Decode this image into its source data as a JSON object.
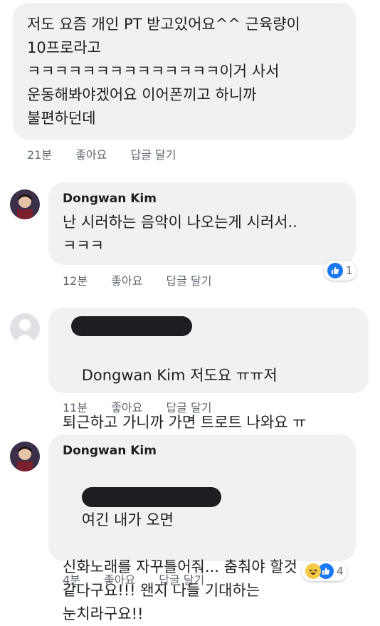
{
  "comment1": {
    "text": "저도 요즘 개인 PT 받고있어요^^ 근육량이\n10프로라고\nㅋㅋㅋㅋㅋㅋㅋㅋㅋㅋㅋㅋㅋㅋ이거 사서\n운동해봐야겠어요 이어폰끼고 하니까\n불편하던데",
    "time": "21분",
    "like": "좋아요",
    "reply": "답글 달기"
  },
  "comment2": {
    "author": "Dongwan Kim",
    "text": "난 시러하는 음악이 나오는게 시러서..\nㅋㅋㅋ",
    "time": "12분",
    "like": "좋아요",
    "reply": "답글 달기",
    "reaction_count": "1"
  },
  "comment3": {
    "mention": "Dongwan Kim",
    "text_line1": " 저도요 ㅠㅠ저",
    "text_line2": "퇴근하고 가니까 가면 트로트 나와요 ㅠ",
    "time": "11분",
    "like": "좋아요",
    "reply": "답글 달기"
  },
  "comment4": {
    "author": "Dongwan Kim",
    "text_line1": "여긴 내가 오면",
    "text_rest": "신화노래를 자꾸틀어줘... 춤춰야 할것\n같다구요!!! 왠지 다들 기대하는\n눈치라구요!!",
    "time": "4분",
    "like": "좋아요",
    "reply": "답글 달기",
    "reaction_count": "4"
  },
  "colors": {
    "bubble": "#f0f1f3",
    "like_blue": "#1877f2",
    "meta_gray": "#606770"
  },
  "icons": [
    "avatar-photo",
    "default-avatar-icon",
    "like-icon",
    "haha-icon"
  ]
}
